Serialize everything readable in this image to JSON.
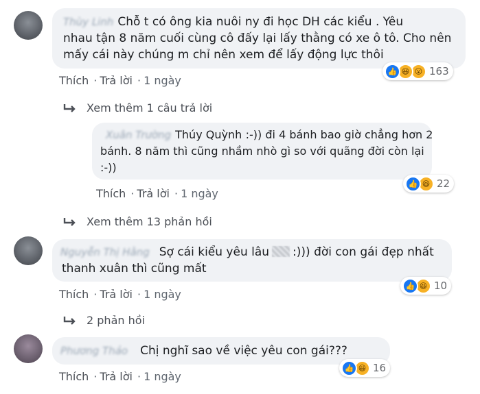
{
  "actions": {
    "like": "Thích",
    "reply": "Trả lời",
    "time": "1 ngày",
    "sep": "·"
  },
  "comments": [
    {
      "author": "Thùy Linh",
      "lines": [
        "Chỗ t có ông kia nuôi ny đi học DH các kiểu . Yêu",
        "nhau tận 8 năm cuối cùng cô đấy lại lấy thằng có xe ô tô. Cho nên",
        "mấy cái này chúng m chỉ nên xem để lấy động lực thôi"
      ],
      "reactions": [
        "like",
        "haha",
        "wow"
      ],
      "reaction_count": "163"
    },
    {
      "author": "Xuân Trường",
      "tag": "Thúy Quỳnh",
      "first_line_rest": ":-)) đi 4 bánh bao giờ chẳng hơn 2",
      "lines": [
        "bánh. 8 năm thì cũng nhầm nhò gì so với quãng đời còn lại",
        ":-))"
      ],
      "reactions": [
        "like",
        "haha"
      ],
      "reaction_count": "22"
    },
    {
      "author": "Nguyễn Thị Hằng",
      "first_line_a": "Sợ cái kiểu yêu lâu",
      "first_line_b": ":))) đời con gái đẹp nhất",
      "lines": [
        "thanh xuân thì cũng mất"
      ],
      "reactions": [
        "like",
        "haha"
      ],
      "reaction_count": "10"
    },
    {
      "author": "Phương Thảo",
      "lines": [
        "Chị nghĩ sao về việc yêu con gái???"
      ],
      "reactions": [
        "like",
        "haha"
      ],
      "reaction_count": "16"
    }
  ],
  "more_replies": {
    "first": "Xem thêm 1 câu trả lời",
    "second": "Xem thêm 13 phản hồi",
    "third": "2 phản hồi"
  },
  "colors": {
    "bubble": "#f0f2f5",
    "like": "#1877f2",
    "haha": "#f7b125",
    "text": "#1c1e21",
    "meta": "#4b4f56"
  },
  "icons": {
    "reply_arrow": "reply-arrow-icon",
    "like": "like-icon",
    "haha": "haha-icon",
    "wow": "wow-icon"
  }
}
